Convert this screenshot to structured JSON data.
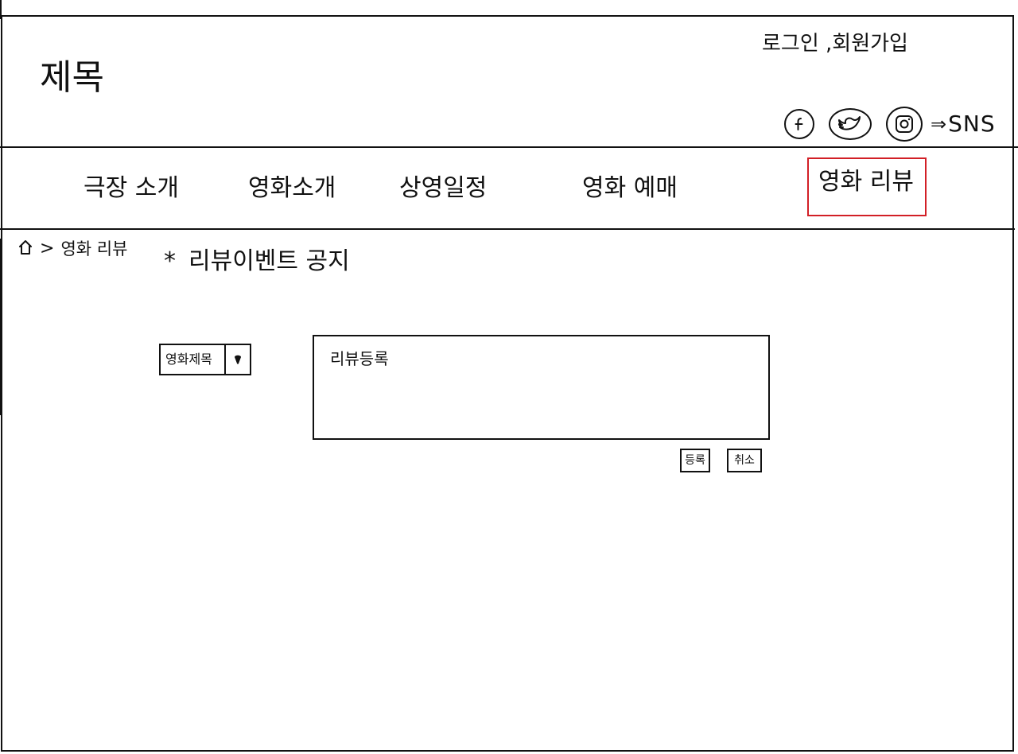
{
  "header": {
    "title": "제목",
    "account_links": "로그인 ,회원가입",
    "sns": {
      "icons": [
        "facebook-icon",
        "twitter-icon",
        "instagram-icon"
      ],
      "arrow": "⇒",
      "label": "SNS"
    }
  },
  "nav": {
    "items": [
      {
        "label": "극장 소개"
      },
      {
        "label": "영화소개"
      },
      {
        "label": "상영일정"
      },
      {
        "label": "영화 예매"
      },
      {
        "label": "영화 리뷰",
        "active": true
      }
    ],
    "active_color": "#d21f26"
  },
  "breadcrumb": {
    "home_icon": "home-icon",
    "separator": ">",
    "current": "영화 리뷰"
  },
  "notice": {
    "marker": "*",
    "text": "리뷰이벤트 공지"
  },
  "review_form": {
    "movie_select": {
      "value": "영화제목"
    },
    "review_placeholder": "리뷰등록",
    "submit_label": "등록",
    "cancel_label": "취소"
  }
}
